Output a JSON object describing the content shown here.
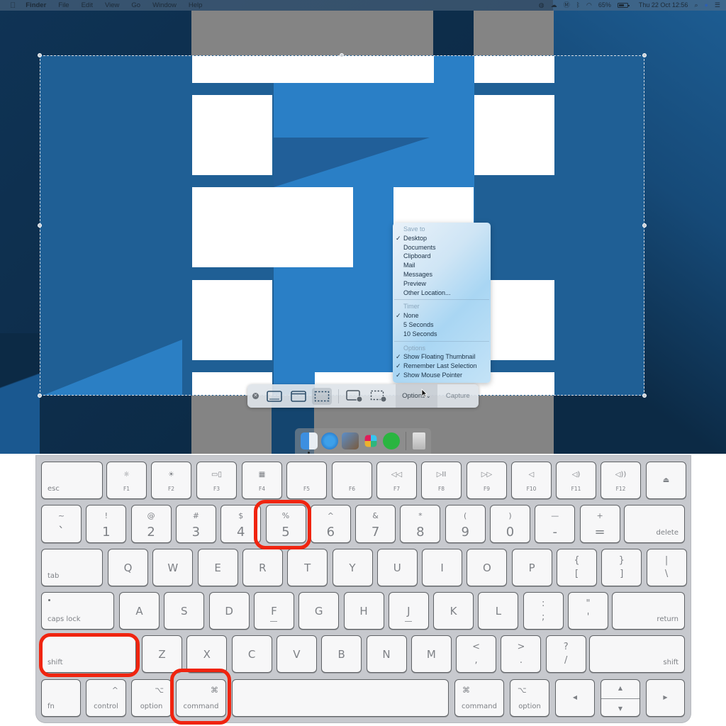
{
  "menubar": {
    "apple_icon": "apple-logo",
    "app_name": "Finder",
    "menus": [
      "File",
      "Edit",
      "View",
      "Go",
      "Window",
      "Help"
    ],
    "status": {
      "battery_percent": "65%",
      "datetime": "Thu 22 Oct  12:56"
    }
  },
  "options_menu": {
    "sections": [
      {
        "title": "Save to",
        "items": [
          {
            "label": "Desktop",
            "checked": true
          },
          {
            "label": "Documents",
            "checked": false
          },
          {
            "label": "Clipboard",
            "checked": false
          },
          {
            "label": "Mail",
            "checked": false
          },
          {
            "label": "Messages",
            "checked": false
          },
          {
            "label": "Preview",
            "checked": false
          },
          {
            "label": "Other Location...",
            "checked": false
          }
        ]
      },
      {
        "title": "Timer",
        "items": [
          {
            "label": "None",
            "checked": true
          },
          {
            "label": "5 Seconds",
            "checked": false
          },
          {
            "label": "10 Seconds",
            "checked": false
          }
        ]
      },
      {
        "title": "Options",
        "items": [
          {
            "label": "Show Floating Thumbnail",
            "checked": true
          },
          {
            "label": "Remember Last Selection",
            "checked": true
          },
          {
            "label": "Show Mouse Pointer",
            "checked": true
          }
        ]
      }
    ],
    "check_glyph": "✓"
  },
  "toolbar": {
    "close_glyph": "✕",
    "options_label": "Options",
    "capture_label": "Capture",
    "modes": [
      {
        "name": "capture-entire-screen",
        "active": false
      },
      {
        "name": "capture-selected-window",
        "active": false
      },
      {
        "name": "capture-selected-portion",
        "active": true
      },
      {
        "name": "record-entire-screen",
        "active": false
      },
      {
        "name": "record-selected-portion",
        "active": false
      }
    ]
  },
  "dock": {
    "apps": [
      "Finder",
      "Safari",
      "Preview",
      "Slack",
      "WhatsApp",
      "Trash"
    ]
  },
  "keyboard": {
    "function_row": [
      {
        "label": "esc",
        "glyph": ""
      },
      {
        "label": "F1",
        "glyph": "☼"
      },
      {
        "label": "F2",
        "glyph": "☀"
      },
      {
        "label": "F3",
        "glyph": "▭▯"
      },
      {
        "label": "F4",
        "glyph": "▦"
      },
      {
        "label": "F5",
        "glyph": ""
      },
      {
        "label": "F6",
        "glyph": ""
      },
      {
        "label": "F7",
        "glyph": "◁◁"
      },
      {
        "label": "F8",
        "glyph": "▷II"
      },
      {
        "label": "F9",
        "glyph": "▷▷"
      },
      {
        "label": "F10",
        "glyph": "◁"
      },
      {
        "label": "F11",
        "glyph": "◁)"
      },
      {
        "label": "F12",
        "glyph": "◁))"
      },
      {
        "label": "",
        "glyph": "⏏"
      }
    ],
    "number_row": [
      {
        "top": "~",
        "bottom": "`"
      },
      {
        "top": "!",
        "bottom": "1"
      },
      {
        "top": "@",
        "bottom": "2"
      },
      {
        "top": "#",
        "bottom": "3"
      },
      {
        "top": "$",
        "bottom": "4"
      },
      {
        "top": "%",
        "bottom": "5"
      },
      {
        "top": "^",
        "bottom": "6"
      },
      {
        "top": "&",
        "bottom": "7"
      },
      {
        "top": "*",
        "bottom": "8"
      },
      {
        "top": "(",
        "bottom": "9"
      },
      {
        "top": ")",
        "bottom": "0"
      },
      {
        "top": "—",
        "bottom": "-"
      },
      {
        "top": "+",
        "bottom": "="
      }
    ],
    "delete_label": "delete",
    "tab_label": "tab",
    "qwerty_row": [
      "Q",
      "W",
      "E",
      "R",
      "T",
      "Y",
      "U",
      "I",
      "O",
      "P"
    ],
    "qwerty_pairs": [
      {
        "top": "{",
        "bottom": "["
      },
      {
        "top": "}",
        "bottom": "]"
      },
      {
        "top": "|",
        "bottom": "\\"
      }
    ],
    "caps_label": "caps lock",
    "home_row": [
      "A",
      "S",
      "D",
      "F",
      "G",
      "H",
      "J",
      "K",
      "L"
    ],
    "home_pairs": [
      {
        "top": ":",
        "bottom": ";"
      },
      {
        "top": "\"",
        "bottom": "'"
      }
    ],
    "return_label": "return",
    "shift_label": "shift",
    "bottom_letters": [
      "Z",
      "X",
      "C",
      "V",
      "B",
      "N",
      "M"
    ],
    "bottom_pairs": [
      {
        "top": "<",
        "bottom": ","
      },
      {
        "top": ">",
        "bottom": "."
      },
      {
        "top": "?",
        "bottom": "/"
      }
    ],
    "modifiers": {
      "fn": "fn",
      "control": "control",
      "control_glyph": "^",
      "option": "option",
      "option_glyph": "⌥",
      "command": "command",
      "command_glyph": "⌘"
    },
    "arrows": {
      "left": "◀",
      "up": "▲",
      "down": "▼",
      "right": "▶"
    },
    "highlighted_keys": [
      "shift",
      "command",
      "5"
    ],
    "highlight_color": "#f0240f"
  }
}
